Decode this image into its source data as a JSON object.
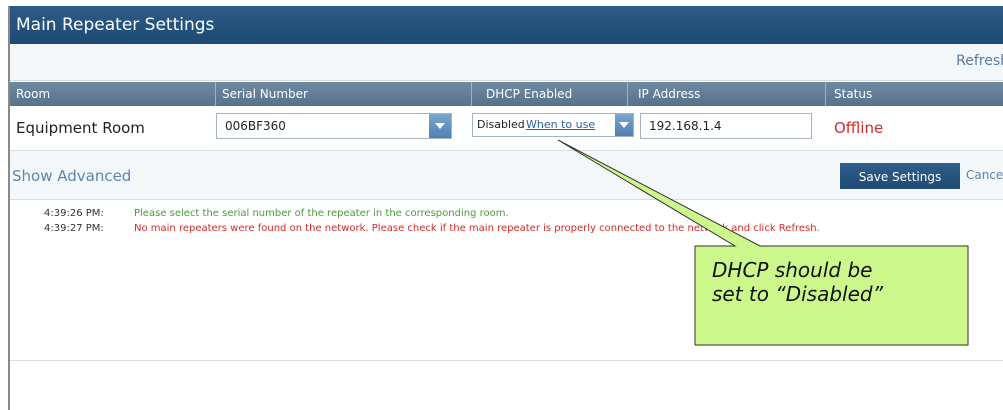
{
  "window": {
    "title": "Main Repeater Settings"
  },
  "toolbar": {
    "refresh_label": "Refresh"
  },
  "table": {
    "headers": [
      "Room",
      "Serial Number",
      "DHCP Enabled",
      "IP Address",
      "Status"
    ],
    "row": {
      "room": "Equipment Room",
      "serial": "006BF360",
      "dhcp_value": "Disabled",
      "dhcp_help_link": "When to use",
      "ip": "192.168.1.4",
      "status": "Offline"
    }
  },
  "actions": {
    "show_advanced": "Show Advanced",
    "save_label": "Save Settings",
    "cancel_label": "Cancel"
  },
  "log": [
    {
      "time": "4:39:26 PM:",
      "message": "Please select the serial number of the repeater in the corresponding room.",
      "level": "info"
    },
    {
      "time": "4:39:27 PM:",
      "message": "No main repeaters were found on the network. Please check if the main repeater is properly connected to the network and click Refresh.",
      "level": "error"
    }
  ],
  "annotation": {
    "callout_text_line1": "DHCP should be",
    "callout_text_line2": "set to “Disabled”"
  },
  "colors": {
    "titlebar": "#1d4a74",
    "header_row": "#58728d",
    "offline": "#d22b2b",
    "info_text": "#4a9a3a",
    "callout_fill": "#ccf78a"
  }
}
